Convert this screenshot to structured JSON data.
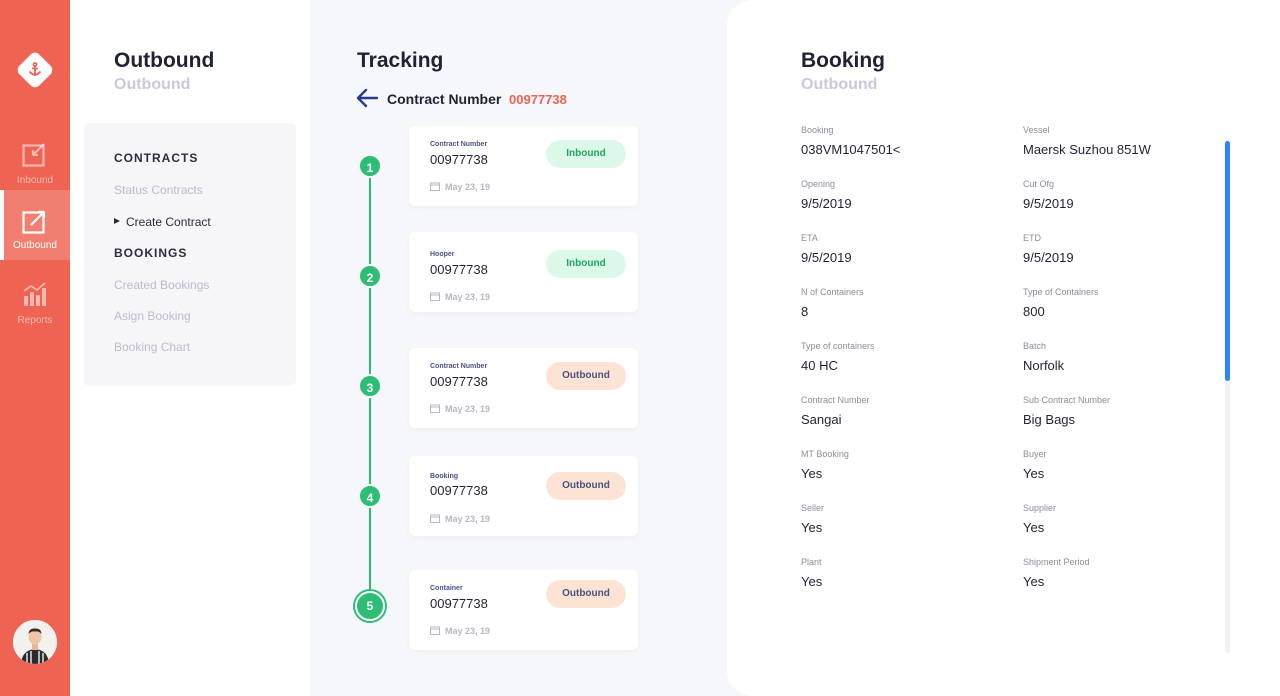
{
  "colors": {
    "accent": "#ee6352",
    "green": "#2dbd74",
    "blue_scroll": "#2e86f0"
  },
  "rail": {
    "logo_icon": "anchor-icon",
    "items": [
      {
        "label": "Inbound",
        "icon": "inbound-edit-icon",
        "active": false
      },
      {
        "label": "Outbound",
        "icon": "outbound-export-icon",
        "active": true
      },
      {
        "label": "Reports",
        "icon": "bar-chart-icon",
        "active": false
      }
    ],
    "avatar_icon": "user-avatar"
  },
  "menu": {
    "title": "Outbound",
    "subtitle": "Outbound",
    "contracts_header": "CONTRACTS",
    "status_contracts": "Status Contracts",
    "create_contract": "Create Contract",
    "bookings_header": "BOOKINGS",
    "created_bookings": "Created Bookings",
    "asign_booking": "Asign Booking",
    "booking_chart": "Booking Chart"
  },
  "tracking": {
    "title": "Tracking",
    "contract_label": "Contract Number",
    "contract_value": "00977738",
    "steps": [
      {
        "num": "1",
        "key": "Contract Number",
        "value": "00977738",
        "date": "May 23, 19",
        "status": "Inbound"
      },
      {
        "num": "2",
        "key": "Hooper",
        "value": "00977738",
        "date": "May 23, 19",
        "status": "Inbound"
      },
      {
        "num": "3",
        "key": "Contract Number",
        "value": "00977738",
        "date": "May 23, 19",
        "status": "Outbound"
      },
      {
        "num": "4",
        "key": "Booking",
        "value": "00977738",
        "date": "May 23, 19",
        "status": "Outbound"
      },
      {
        "num": "5",
        "key": "Container",
        "value": "00977738",
        "date": "May 23, 19",
        "status": "Outbound"
      }
    ]
  },
  "booking": {
    "title": "Booking",
    "subtitle": "Outbound",
    "fields": [
      {
        "label": "Booking",
        "value": "038VM1047501<"
      },
      {
        "label": "Vessel",
        "value": "Maersk Suzhou 851W"
      },
      {
        "label": "Opening",
        "value": "9/5/2019"
      },
      {
        "label": "Cut Ofg",
        "value": "9/5/2019"
      },
      {
        "label": "ETA",
        "value": "9/5/2019"
      },
      {
        "label": "ETD",
        "value": "9/5/2019"
      },
      {
        "label": "N of Containers",
        "value": "8"
      },
      {
        "label": "Type of Containers",
        "value": "800"
      },
      {
        "label": "Type of containers",
        "value": "40 HC"
      },
      {
        "label": "Batch",
        "value": "Norfolk"
      },
      {
        "label": "Contract Number",
        "value": "Sangai"
      },
      {
        "label": "Sub Contract Number",
        "value": "Big Bags"
      },
      {
        "label": "MT Booking",
        "value": "Yes"
      },
      {
        "label": "Buyer",
        "value": "Yes"
      },
      {
        "label": "Seller",
        "value": "Yes"
      },
      {
        "label": "Supplier",
        "value": "Yes"
      },
      {
        "label": "Plant",
        "value": "Yes"
      },
      {
        "label": "Shipment Period",
        "value": "Yes"
      }
    ]
  }
}
